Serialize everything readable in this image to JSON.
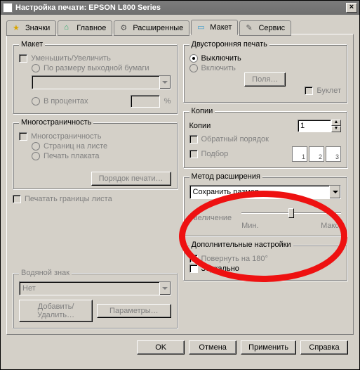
{
  "window": {
    "title": "Настройка печати: EPSON L800 Series"
  },
  "tabs": {
    "icons": {
      "label": "Значки"
    },
    "main": {
      "label": "Главное"
    },
    "advanced": {
      "label": "Расширенные"
    },
    "layout": {
      "label": "Макет"
    },
    "service": {
      "label": "Сервис"
    }
  },
  "layout_group": {
    "legend": "Макет",
    "scale": "Уменьшить/Увеличить",
    "fit": "По размеру выходной бумаги",
    "percent": "В процентах",
    "percent_unit": "%"
  },
  "multipage": {
    "legend": "Многостраничность",
    "pages_per_sheet": "Страниц на листе",
    "poster": "Печать плаката",
    "order_btn": "Порядок печати…"
  },
  "borders_chk": "Печатать границы листа",
  "watermark": {
    "legend": "Водяной знак",
    "select": "Нет",
    "add_btn": "Добавить/Удалить…",
    "param_btn": "Параметры…"
  },
  "duplex": {
    "legend": "Двусторонняя печать",
    "off": "Выключить",
    "on": "Включить",
    "margins_btn": "Поля…",
    "booklet": "Буклет"
  },
  "copies": {
    "legend": "Копии",
    "label": "Копии",
    "value": "1",
    "reverse": "Обратный порядок",
    "collate": "Подбор",
    "num1": "1",
    "num2": "2",
    "num3": "3"
  },
  "expansion": {
    "legend": "Метод расширения",
    "select": "Сохранить размер",
    "zoom_label": "Увеличение",
    "min": "Мин.",
    "max": "Макс."
  },
  "extras": {
    "legend": "Дополнительные настройки",
    "rotate": "Повернуть на 180°",
    "mirror": "Зеркально"
  },
  "buttons": {
    "ok": "OK",
    "cancel": "Отмена",
    "apply": "Применить",
    "help": "Справка"
  }
}
